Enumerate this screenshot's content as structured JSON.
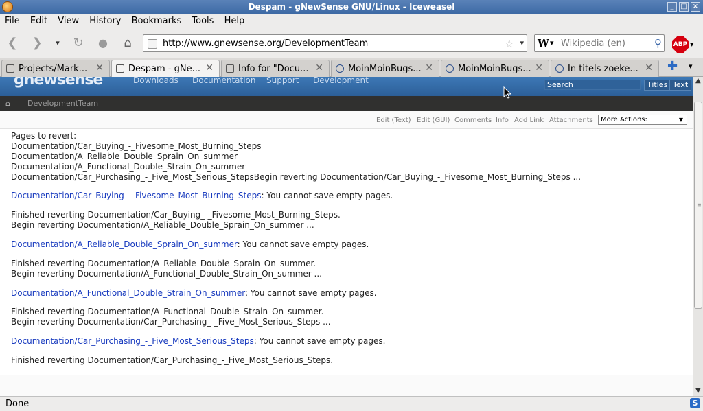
{
  "window": {
    "title": "Despam - gNewSense GNU/Linux - Iceweasel"
  },
  "menu": [
    "File",
    "Edit",
    "View",
    "History",
    "Bookmarks",
    "Tools",
    "Help"
  ],
  "navbar": {
    "url": "http://www.gnewsense.org/DevelopmentTeam",
    "search_engine": "W",
    "search_placeholder": "Wikipedia (en)",
    "abp_label": "ABP"
  },
  "tabs": [
    {
      "label": "Projects/Mark...",
      "active": false
    },
    {
      "label": "Despam - gNe...",
      "active": true
    },
    {
      "label": "Info for \"Docu...",
      "active": false
    },
    {
      "label": "MoinMoinBugs...",
      "active": false
    },
    {
      "label": "MoinMoinBugs...",
      "active": false
    },
    {
      "label": "In titels zoeke...",
      "active": false
    }
  ],
  "site": {
    "logo": "gnewsense",
    "nav": [
      "Downloads",
      "Documentation",
      "Support",
      "Development"
    ],
    "search_label": "Search",
    "titles_btn": "Titles",
    "text_btn": "Text",
    "breadcrumb": "DevelopmentTeam",
    "actions": [
      "Edit (Text)",
      "Edit (GUI)",
      "Comments",
      "Info",
      "Add Link",
      "Attachments"
    ],
    "more_actions": "More Actions:"
  },
  "content": {
    "header_lines": [
      "Pages to revert:",
      "Documentation/Car_Buying_-_Fivesome_Most_Burning_Steps",
      "Documentation/A_Reliable_Double_Sprain_On_summer",
      "Documentation/A_Functional_Double_Strain_On_summer",
      "Documentation/Car_Purchasing_-_Five_Most_Serious_StepsBegin reverting Documentation/Car_Buying_-_Fivesome_Most_Burning_Steps ..."
    ],
    "blocks": [
      {
        "link": "Documentation/Car_Buying_-_Fivesome_Most_Burning_Steps",
        "error": ": You cannot save empty pages.",
        "finished": "Finished reverting Documentation/Car_Buying_-_Fivesome_Most_Burning_Steps.",
        "begin": "Begin reverting Documentation/A_Reliable_Double_Sprain_On_summer ..."
      },
      {
        "link": "Documentation/A_Reliable_Double_Sprain_On_summer",
        "error": ": You cannot save empty pages.",
        "finished": "Finished reverting Documentation/A_Reliable_Double_Sprain_On_summer.",
        "begin": "Begin reverting Documentation/A_Functional_Double_Strain_On_summer ..."
      },
      {
        "link": "Documentation/A_Functional_Double_Strain_On_summer",
        "error": ": You cannot save empty pages.",
        "finished": "Finished reverting Documentation/A_Functional_Double_Strain_On_summer.",
        "begin": "Begin reverting Documentation/Car_Purchasing_-_Five_Most_Serious_Steps ..."
      },
      {
        "link": "Documentation/Car_Purchasing_-_Five_Most_Serious_Steps",
        "error": ": You cannot save empty pages.",
        "finished": "Finished reverting Documentation/Car_Purchasing_-_Five_Most_Serious_Steps.",
        "begin": ""
      }
    ]
  },
  "status": {
    "text": "Done",
    "icon": "S"
  },
  "colors": {
    "link": "#1a3cbf",
    "header_blue": "#2c5f98",
    "breadcrumb_bg": "#30302f"
  }
}
